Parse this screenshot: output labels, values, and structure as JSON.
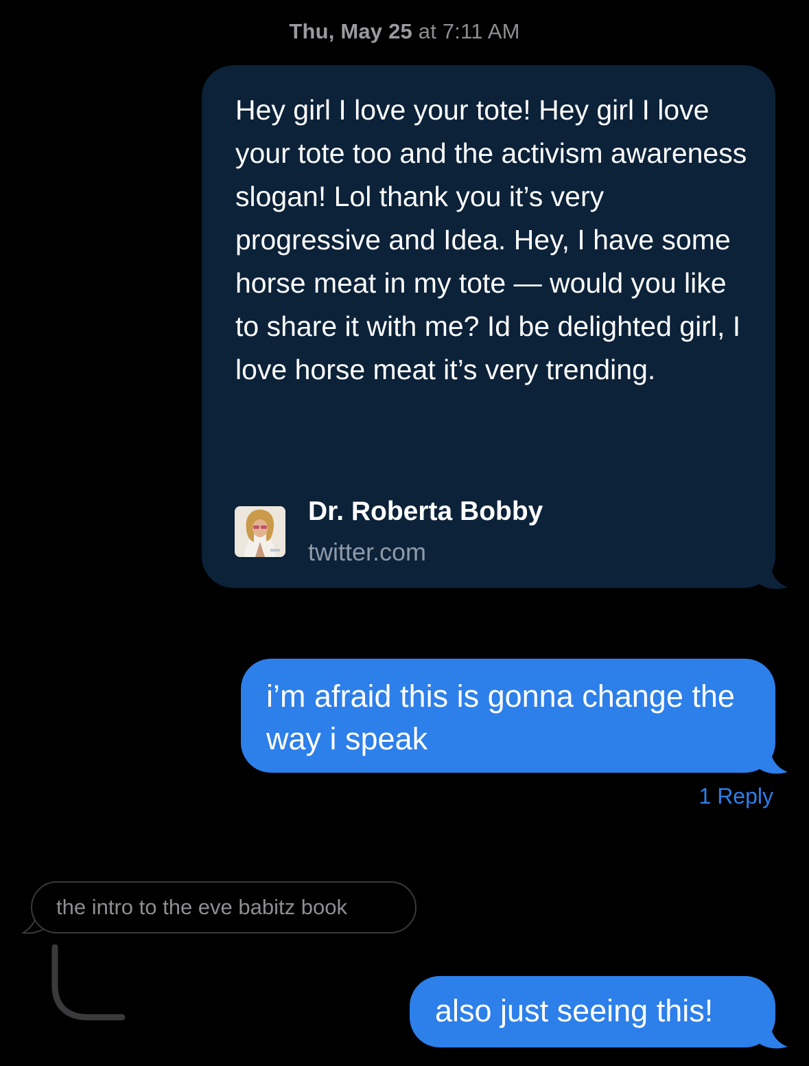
{
  "conversation": {
    "timestamp_day": "Thu, May 25",
    "timestamp_time": " at 7:11 AM"
  },
  "link_preview": {
    "quote": "Hey girl I love your tote! Hey girl I love your tote too and the activism awareness slogan! Lol thank you it’s very progressive and Idea. Hey, I have some horse meat in my tote — would you like to share it with me? Id be delighted girl, I love horse meat it’s very trending.",
    "title": "Dr. Roberta Bobby",
    "domain": "twitter.com",
    "thumbnail_icon": "profile-photo-icon"
  },
  "messages": [
    {
      "text": "i’m afraid this is gonna change the way i speak",
      "reply_label": "1 Reply"
    },
    {
      "quoted_text": "the intro to the eve babitz book"
    },
    {
      "text": "also just seeing this!"
    }
  ],
  "colors": {
    "background": "#000000",
    "sent_bubble": "#2d7fea",
    "link_bubble": "#0c2239",
    "timestamp": "#8e8e93",
    "reply_link": "#2d7fea"
  }
}
